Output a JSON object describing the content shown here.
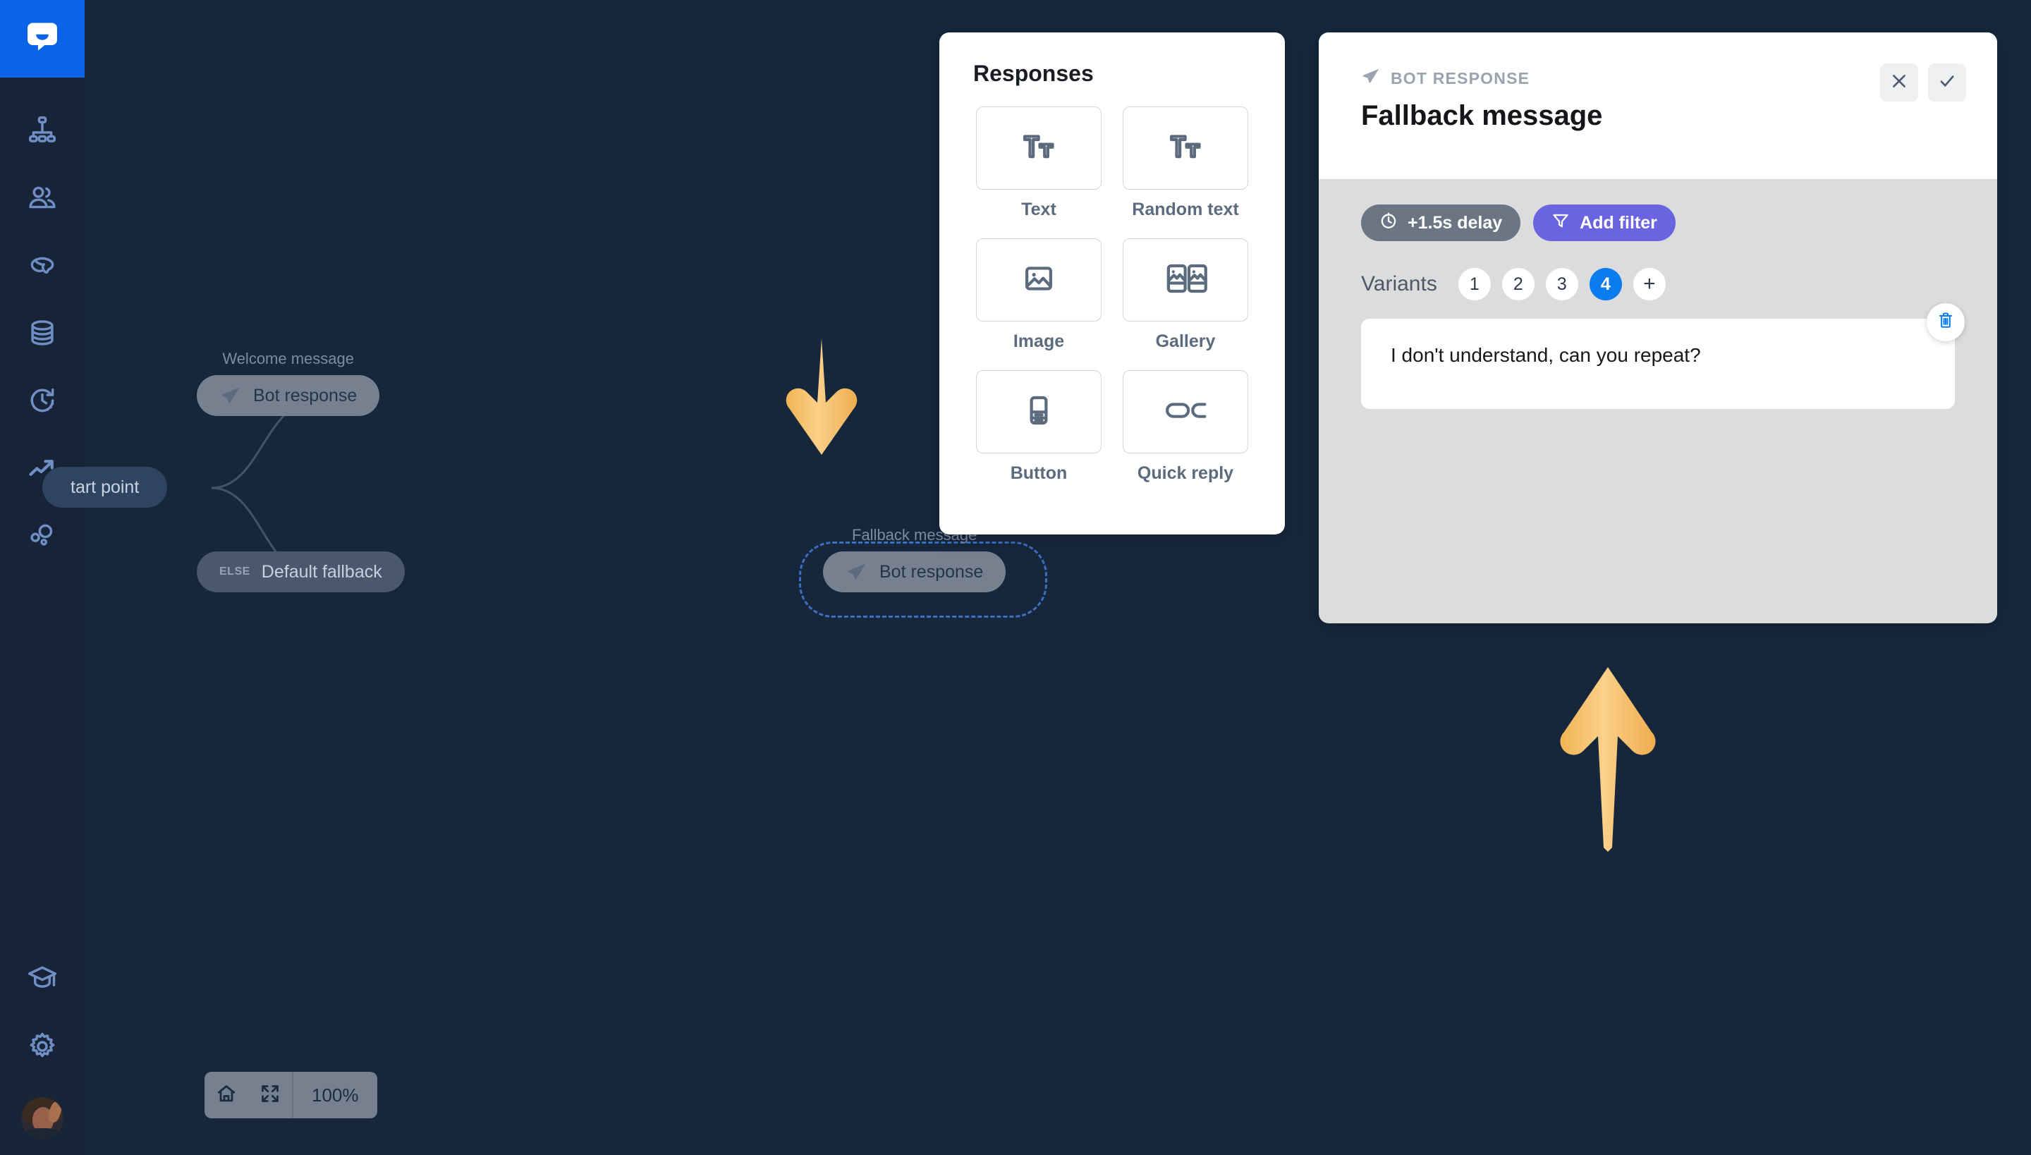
{
  "brand": {
    "logo_icon": "chatbot-logo-icon",
    "accent_blue": "#0b64e8",
    "canvas_bg": "#16273c",
    "sidebar_bg": "#172337",
    "panel_body_bg": "#dcdcdc",
    "filter_purple": "#6b64e0",
    "active_blue": "#0b7bf0",
    "arrow_gold": "#f5c06a"
  },
  "sidebar": {
    "items": [
      {
        "icon": "org-chart-icon",
        "name": "sidebar-item-stories"
      },
      {
        "icon": "users-icon",
        "name": "sidebar-item-users"
      },
      {
        "icon": "brain-icon",
        "name": "sidebar-item-training"
      },
      {
        "icon": "database-icon",
        "name": "sidebar-item-data"
      },
      {
        "icon": "history-clock-icon",
        "name": "sidebar-item-archives"
      },
      {
        "icon": "trending-up-icon",
        "name": "sidebar-item-reports"
      },
      {
        "icon": "bubbles-icon",
        "name": "sidebar-item-integrations"
      }
    ],
    "bottom_items": [
      {
        "icon": "graduation-cap-icon",
        "name": "sidebar-item-academy"
      },
      {
        "icon": "gear-icon",
        "name": "sidebar-item-settings"
      }
    ],
    "avatar_name": "user-avatar"
  },
  "canvas": {
    "nodes": {
      "start": {
        "label": "tart point",
        "name": "node-start-point"
      },
      "welcome": {
        "group_label": "Welcome message",
        "label": "Bot response",
        "icon": "paper-plane-icon"
      },
      "fallback_condition": {
        "tag": "ELSE",
        "label": "Default fallback"
      },
      "fallback_response": {
        "group_label": "Fallback message",
        "label": "Bot response",
        "icon": "paper-plane-icon",
        "selected": true
      }
    },
    "zoombar": {
      "home_icon": "home-icon",
      "fit_icon": "fit-screen-icon",
      "zoom_level": "100%"
    }
  },
  "responses_panel": {
    "title": "Responses",
    "items": [
      {
        "label": "Text",
        "icon": "text-format-icon"
      },
      {
        "label": "Random text",
        "icon": "text-format-icon"
      },
      {
        "label": "Image",
        "icon": "image-icon"
      },
      {
        "label": "Gallery",
        "icon": "gallery-icon"
      },
      {
        "label": "Button",
        "icon": "button-card-icon"
      },
      {
        "label": "Quick reply",
        "icon": "quick-reply-icon"
      }
    ]
  },
  "detail_panel": {
    "eyebrow": "BOT RESPONSE",
    "eyebrow_icon": "paper-plane-icon",
    "title": "Fallback message",
    "close_icon": "close-icon",
    "confirm_icon": "check-icon",
    "delay_chip": {
      "label": "+1.5s delay",
      "icon": "clock-icon"
    },
    "filter_chip": {
      "label": "Add filter",
      "icon": "funnel-icon"
    },
    "variants_label": "Variants",
    "variants": [
      "1",
      "2",
      "3",
      "4"
    ],
    "active_variant": "4",
    "add_variant_label": "+",
    "variant_text": "I don't understand, can you repeat?",
    "delete_icon": "trash-icon"
  },
  "annotations": {
    "arrow_down": "arrow-down-annotation",
    "arrow_up": "arrow-up-annotation"
  }
}
